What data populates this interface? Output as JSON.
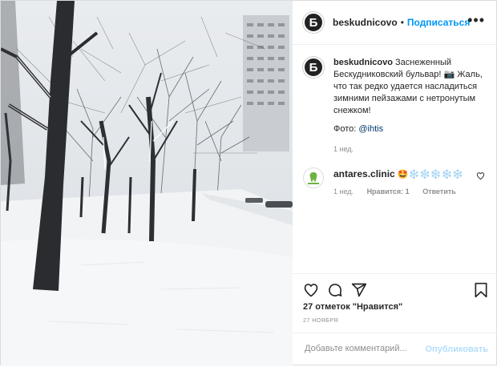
{
  "post": {
    "author": {
      "username": "beskudnicovo",
      "avatar_letter": "Б",
      "follow_label": "Подписаться"
    },
    "caption": {
      "text": "Заснеженный Бескудниковский бульвар! 📷 Жаль, что так редко удается насладиться зимними пейзажами с нетронутым снежком!",
      "photo_credit_prefix": "Фото: ",
      "photo_credit_mention": "@ihtis",
      "time": "1 нед."
    },
    "comments": [
      {
        "username": "antares.clinic",
        "text": "🤩❄️❄️❄️❄️❄️",
        "time": "1 нед.",
        "likes": "Нравится: 1",
        "reply_label": "Ответить",
        "avatar_icon": "tooth-clinic-logo"
      }
    ],
    "likes_text": "27 отметок \"Нравится\"",
    "date": "27 ноября",
    "add_comment": {
      "placeholder": "Добавьте комментарий...",
      "publish_label": "Опубликовать"
    },
    "colors": {
      "accent": "#0095f6",
      "publish_disabled": "#b2dffc",
      "meta_gray": "#8e8e8e",
      "text": "#262626"
    },
    "icons": [
      "heart-icon",
      "comment-icon",
      "share-icon",
      "bookmark-icon",
      "more-icon"
    ]
  }
}
